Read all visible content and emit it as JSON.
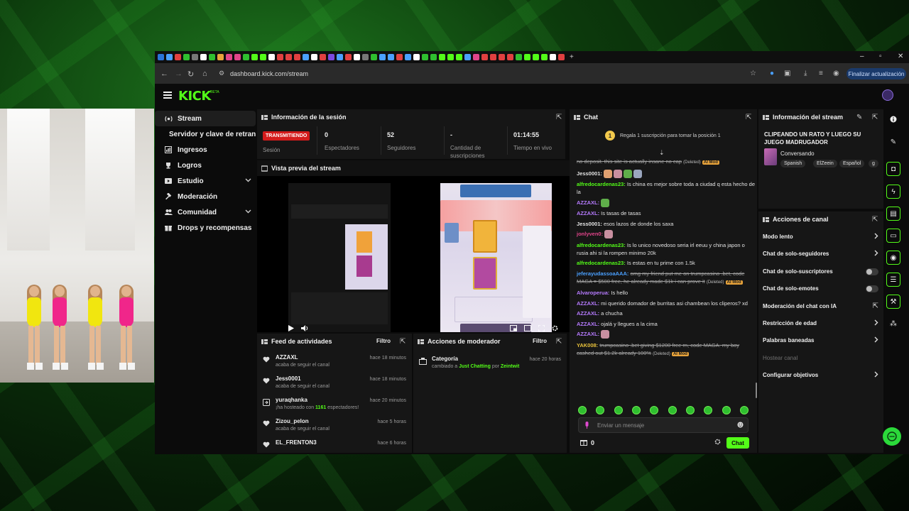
{
  "browser": {
    "url": "dashboard.kick.com/stream",
    "update_button": "Finalizar actualización",
    "tab_favicon_colors": [
      "#2a74d9",
      "#4aa0ff",
      "#e04040",
      "#2fbf2f",
      "#777",
      "#ffffff",
      "#2fbf2f",
      "#e9a23b",
      "#e0448a",
      "#e0448a",
      "#2fbf2f",
      "#53fc18",
      "#53fc18",
      "#ffffff",
      "#e04040",
      "#e04040",
      "#e04040",
      "#4aa0ff",
      "#ffffff",
      "#e04040",
      "#7b4ae0",
      "#4aa0ff",
      "#e04040",
      "#ffffff",
      "#777",
      "#2fbf2f",
      "#4aa0ff",
      "#4aa0ff",
      "#e04040",
      "#4aa0ff",
      "#ffffff",
      "#2fbf2f",
      "#2fbf2f",
      "#53fc18",
      "#53fc18",
      "#53fc18",
      "#4aa0ff",
      "#e0448a",
      "#e04040",
      "#e04040",
      "#e04040",
      "#e04040",
      "#2fbf2f",
      "#53fc18",
      "#53fc18",
      "#53fc18",
      "#ffffff",
      "#e04040"
    ]
  },
  "brand": {
    "logo": "KICK",
    "beta": "BETA",
    "accent": "#53fc18",
    "live_red": "#d41c1c"
  },
  "sidebar": {
    "items": [
      {
        "label": "Stream",
        "icon": "stream-icon",
        "active": true
      },
      {
        "label": "Servidor y clave de retransmisión",
        "sub": true
      },
      {
        "label": "Ingresos",
        "icon": "chart-icon"
      },
      {
        "label": "Logros",
        "icon": "trophy-icon"
      },
      {
        "label": "Estudio",
        "icon": "studio-icon",
        "expandable": true
      },
      {
        "label": "Moderación",
        "icon": "hammer-icon"
      },
      {
        "label": "Comunidad",
        "icon": "people-icon",
        "expandable": true
      },
      {
        "label": "Drops y recompensas",
        "icon": "gift-icon"
      }
    ]
  },
  "session": {
    "title": "Información de la sesión",
    "live_badge": "TRANSMITIENDO",
    "live_label": "Sesión",
    "stats": [
      {
        "value": "0",
        "label": "Espectadores"
      },
      {
        "value": "52",
        "label": "Seguidores"
      },
      {
        "value": "-",
        "label": "Cantidad de suscripciones"
      },
      {
        "value": "01:14:55",
        "label": "Tiempo en vivo"
      }
    ]
  },
  "preview": {
    "title": "Vista previa del stream"
  },
  "feed": {
    "title": "Feed de actividades",
    "filter": "Filtro",
    "items": [
      {
        "name": "AZZAXL",
        "desc": "acaba de seguir el canal",
        "time": "hace 18 minutos",
        "icon": "heart-icon"
      },
      {
        "name": "Jess0001",
        "desc": "acaba de seguir el canal",
        "time": "hace 18 minutos",
        "icon": "heart-icon"
      },
      {
        "name": "yuraqhanka",
        "desc_pre": "¡ha hosteado con ",
        "desc_num": "1161",
        "desc_post": " espectadores!",
        "time": "hace 20 minutos",
        "icon": "host-icon"
      },
      {
        "name": "Zizou_pelon",
        "desc": "acaba de seguir el canal",
        "time": "hace 5 horas",
        "icon": "heart-icon"
      },
      {
        "name": "EL_FRENTON3",
        "desc": "",
        "time": "hace 6 horas",
        "icon": "heart-icon"
      }
    ]
  },
  "mod_actions": {
    "title": "Acciones de moderador",
    "filter": "Filtro",
    "item": {
      "name": "Categoría",
      "desc_pre": "cambiado a ",
      "desc_cat": "Just Chatting",
      "desc_mid": " por ",
      "desc_user": "Zeintwit",
      "time": "hace 20 horas"
    }
  },
  "chat": {
    "title": "Chat",
    "pin_rank": "1",
    "pin_text": "Regala 1 suscripción para tomar la posición 1",
    "input_placeholder": "Enviar un mensaje",
    "send_label": "Chat",
    "count": "0",
    "messages": [
      {
        "user": "",
        "text": "no deposit. this site is actually insane no cap",
        "deleted": true,
        "del": "(Deleted)",
        "tag": "AI Mod",
        "color": "#e2e2e2"
      },
      {
        "user": "Jess0001:",
        "text": "",
        "emotes": 4,
        "color": "#e2e2e2"
      },
      {
        "user": "alfredocardenas23:",
        "text": "Is china es mejor sobre toda a ciudad q esta hecho de la",
        "color": "#53fc18"
      },
      {
        "user": "AZZAXL:",
        "text": "",
        "emotes": 1,
        "color": "#b77bff"
      },
      {
        "user": "AZZAXL:",
        "text": "Is tasas de tasas",
        "color": "#b77bff"
      },
      {
        "user": "Jess0001:",
        "text": "esos lazos de donde los saxa",
        "color": "#e2e2e2"
      },
      {
        "user": "jonlyven0:",
        "text": "",
        "emotes": 1,
        "color": "#e0448a"
      },
      {
        "user": "alfredocardenas23:",
        "text": "Is lo unico novedoso seria irl eeuu y china japon o rusia ahi si la rompen minimo 20k",
        "color": "#53fc18"
      },
      {
        "user": "alfredocardenas23:",
        "text": "Is estas en tu prime con 1.5k",
        "color": "#53fc18"
      },
      {
        "user": "jeferayudassoaAAA:",
        "text": "omg my friend put me on trumpcasino .bet, code MAGA = $500 free, he already made $1k i can prove it",
        "deleted": true,
        "del": "(Deleted)",
        "tag": "AI Mod",
        "color": "#4aa0ff"
      },
      {
        "user": "Alvaroperua:",
        "text": "Is hello",
        "color": "#b77bff"
      },
      {
        "user": "AZZAXL:",
        "text": "mi querido domador de burritas asi chambean los cliperos? xd",
        "color": "#b77bff"
      },
      {
        "user": "AZZAXL:",
        "text": "a chucha",
        "color": "#b77bff"
      },
      {
        "user": "AZZAXL:",
        "text": "ojalá y llegues a la cima",
        "color": "#b77bff"
      },
      {
        "user": "AZZAXL:",
        "text": "",
        "emotes": 1,
        "color": "#b77bff"
      },
      {
        "user": "YAK008:",
        "text": "trumpcasino .bet giving $1200 free rn, code MAGA. my boy cashed out $1.2k already 100%",
        "deleted": true,
        "del": "(Deleted)",
        "tag": "AI Mod",
        "color": "#e9c23b"
      }
    ]
  },
  "stream_info": {
    "title": "Información del stream",
    "stream_title": "CLIPEANDO UN RATO Y LUEGO SU JUEGO MADRUGADOR",
    "category": "Conversando",
    "tags": [
      "Spanish",
      "ElZeein",
      "Español",
      "g"
    ]
  },
  "channel_actions": {
    "title": "Acciones de canal",
    "items": [
      {
        "label": "Modo lento",
        "control": "chevron"
      },
      {
        "label": "Chat de solo-seguidores",
        "control": "chevron"
      },
      {
        "label": "Chat de solo-suscriptores",
        "control": "toggle"
      },
      {
        "label": "Chat de solo-emotes",
        "control": "toggle"
      },
      {
        "label": "Moderación del chat con IA",
        "control": "link"
      },
      {
        "label": "Restricción de edad",
        "control": "chevron"
      },
      {
        "label": "Palabras baneadas",
        "control": "chevron"
      },
      {
        "label": "Hostear canal",
        "control": "none",
        "disabled": true
      },
      {
        "label": "Configurar objetivos",
        "control": "chevron"
      }
    ]
  }
}
